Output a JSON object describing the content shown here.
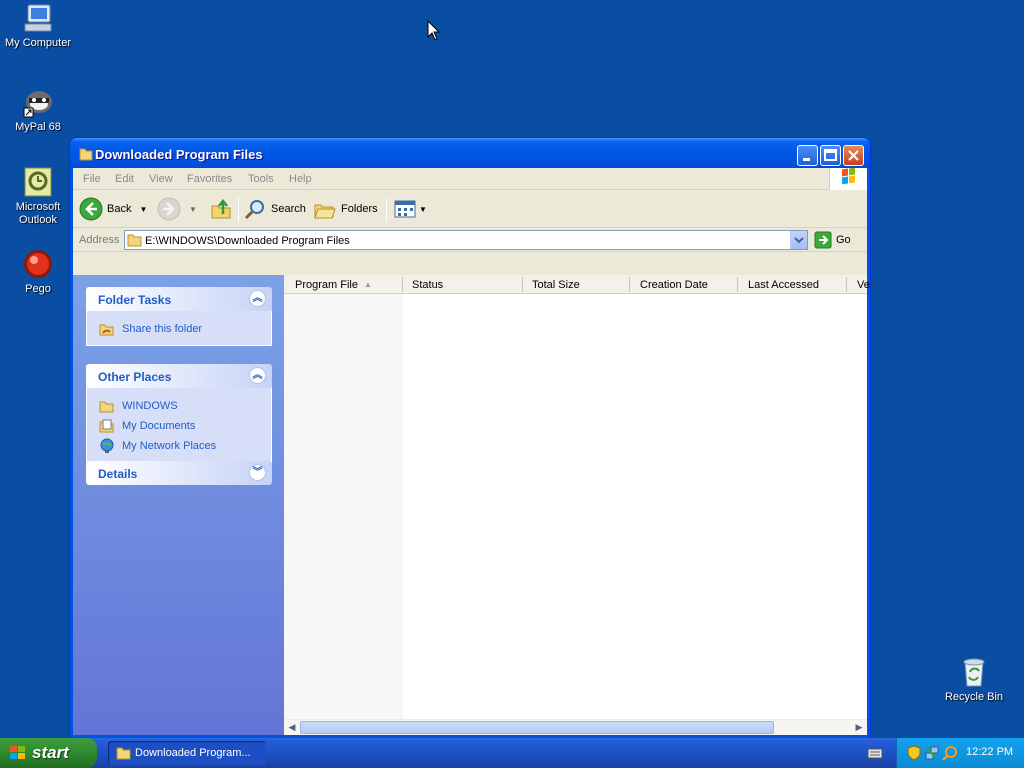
{
  "desktop": {
    "icons": [
      {
        "label": "My Computer"
      },
      {
        "label": "MyPal 68"
      },
      {
        "label": "Microsoft Outlook"
      },
      {
        "label": "Pego"
      },
      {
        "label": "Recycle Bin"
      }
    ]
  },
  "window": {
    "title": "Downloaded Program Files",
    "menu": [
      "File",
      "Edit",
      "View",
      "Favorites",
      "Tools",
      "Help"
    ],
    "toolbar": {
      "back_label": "Back",
      "search_label": "Search",
      "folders_label": "Folders"
    },
    "address": {
      "label": "Address",
      "value": "E:\\WINDOWS\\Downloaded Program Files",
      "go_label": "Go"
    },
    "sidebar": {
      "folder_tasks": {
        "title": "Folder Tasks",
        "items": [
          "Share this folder"
        ]
      },
      "other_places": {
        "title": "Other Places",
        "items": [
          "WINDOWS",
          "My Documents",
          "My Network Places"
        ]
      },
      "details": {
        "title": "Details"
      }
    },
    "columns": [
      "Program File",
      "Status",
      "Total Size",
      "Creation Date",
      "Last Accessed",
      "Ve"
    ],
    "rows": []
  },
  "taskbar": {
    "start_label": "start",
    "tasks": [
      "Downloaded Program..."
    ],
    "clock": "12:22 PM"
  },
  "colors": {
    "desktop": "#0a4ea3",
    "titlebar": "#0055e5",
    "link": "#215dc6",
    "start": "#2f8a2f"
  }
}
